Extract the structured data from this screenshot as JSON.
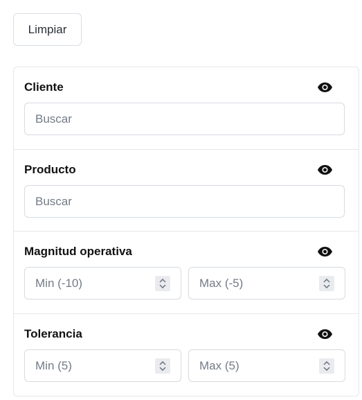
{
  "toolbar": {
    "clear_label": "Limpiar"
  },
  "filters": [
    {
      "label": "Cliente",
      "placeholder": "Buscar"
    },
    {
      "label": "Producto",
      "placeholder": "Buscar"
    },
    {
      "label": "Magnitud operativa",
      "min_placeholder": "Min (-10)",
      "max_placeholder": "Max (-5)"
    },
    {
      "label": "Tolerancia",
      "min_placeholder": "Min (5)",
      "max_placeholder": "Max (5)"
    }
  ],
  "icons": {
    "visibility": "eye-icon",
    "stepper": "stepper-icon"
  },
  "colors": {
    "border": "#d6dae0",
    "placeholder": "#737b86",
    "text": "#111111"
  }
}
